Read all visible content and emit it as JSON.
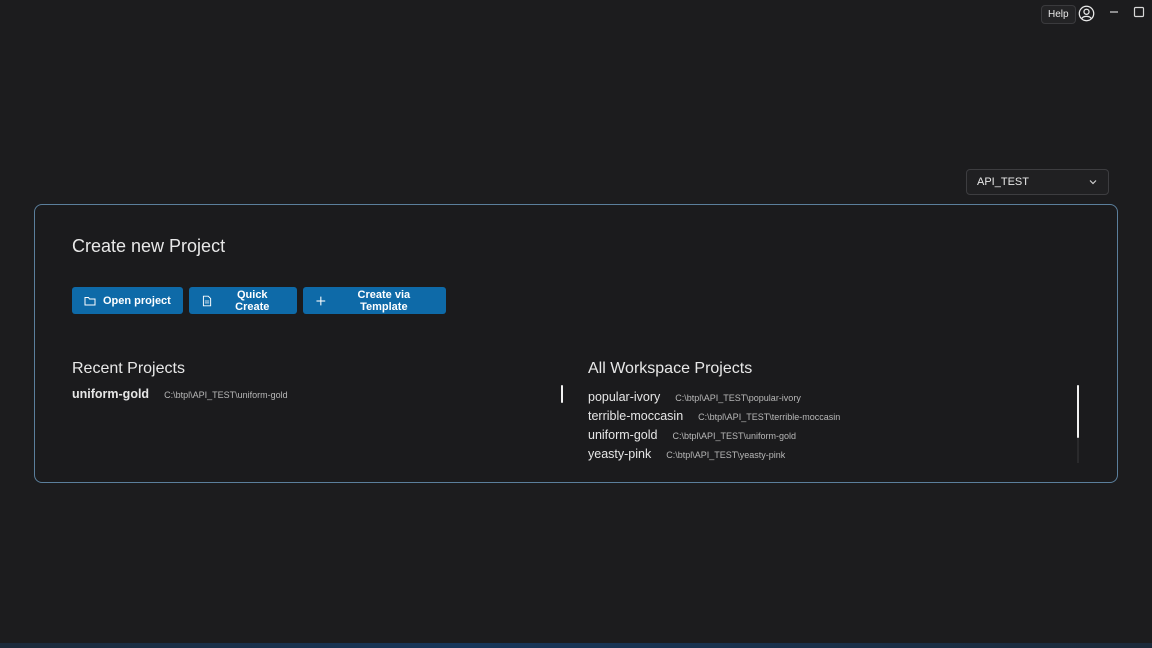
{
  "titlebar": {
    "help_label": "Help",
    "icons": [
      "user-circle-icon",
      "minimize-icon",
      "maximize-icon"
    ]
  },
  "workspace_select": {
    "value": "API_TEST",
    "icon": "chevron-down-icon"
  },
  "create_card": {
    "title": "Create new Project",
    "buttons": {
      "open": "Open project",
      "quick": "Quick Create",
      "template": "Create via Template"
    }
  },
  "recent": {
    "title": "Recent Projects",
    "items": [
      {
        "name": "uniform-gold",
        "path": "C:\\btpl\\API_TEST\\uniform-gold"
      }
    ]
  },
  "all": {
    "title": "All Workspace Projects",
    "items": [
      {
        "name": "popular-ivory",
        "path": "C:\\btpl\\API_TEST\\popular-ivory"
      },
      {
        "name": "terrible-moccasin",
        "path": "C:\\btpl\\API_TEST\\terrible-moccasin"
      },
      {
        "name": "uniform-gold",
        "path": "C:\\btpl\\API_TEST\\uniform-gold"
      },
      {
        "name": "yeasty-pink",
        "path": "C:\\btpl\\API_TEST\\yeasty-pink"
      }
    ]
  },
  "colors": {
    "background": "#1c1c1e",
    "accent": "#0e6aa8",
    "card_border": "#5b7f9c"
  }
}
